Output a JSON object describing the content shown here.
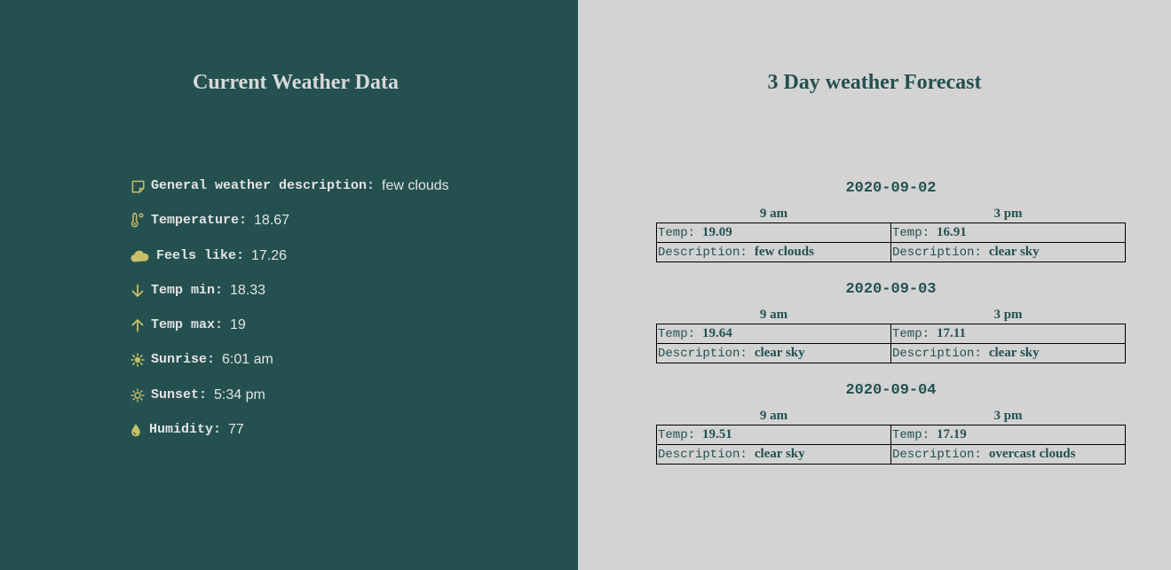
{
  "current": {
    "title": "Current Weather Data",
    "icon_color": "#c8c068",
    "items": [
      {
        "icon": "note-icon",
        "label": "General weather description:",
        "value": "few clouds"
      },
      {
        "icon": "thermometer-icon",
        "label": "Temperature:",
        "value": "18.67"
      },
      {
        "icon": "cloud-icon",
        "label": "Feels like:",
        "value": "17.26"
      },
      {
        "icon": "arrow-down-icon",
        "label": "Temp min:",
        "value": "18.33"
      },
      {
        "icon": "arrow-up-icon",
        "label": "Temp max:",
        "value": "19"
      },
      {
        "icon": "sun-icon",
        "label": "Sunrise:",
        "value": "6:01 am"
      },
      {
        "icon": "sun-outline-icon",
        "label": "Sunset:",
        "value": "5:34 pm"
      },
      {
        "icon": "droplet-icon",
        "label": "Humidity:",
        "value": "77"
      }
    ]
  },
  "forecast": {
    "title": "3 Day weather Forecast",
    "temp_key": "Temp:",
    "desc_key": "Description:",
    "days": [
      {
        "date": "2020-09-02",
        "slots": [
          {
            "time": "9 am",
            "temp": "19.09",
            "description": "few clouds"
          },
          {
            "time": "3 pm",
            "temp": "16.91",
            "description": "clear sky"
          }
        ]
      },
      {
        "date": "2020-09-03",
        "slots": [
          {
            "time": "9 am",
            "temp": "19.64",
            "description": "clear sky"
          },
          {
            "time": "3 pm",
            "temp": "17.11",
            "description": "clear sky"
          }
        ]
      },
      {
        "date": "2020-09-04",
        "slots": [
          {
            "time": "9 am",
            "temp": "19.51",
            "description": "clear sky"
          },
          {
            "time": "3 pm",
            "temp": "17.19",
            "description": "overcast clouds"
          }
        ]
      }
    ]
  },
  "colors": {
    "left_bg": "#245050",
    "right_bg": "#d3d3d3",
    "accent": "#245050"
  }
}
